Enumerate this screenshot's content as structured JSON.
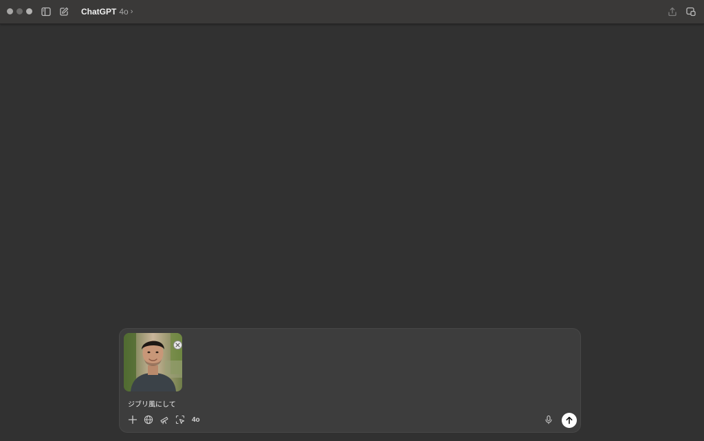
{
  "window": {
    "title": "ChatGPT",
    "model": "4o",
    "chevron": "›"
  },
  "icons": {
    "sidebar": "sidebar-toggle-icon",
    "new_chat": "compose-icon",
    "share": "share-icon",
    "window_mode": "companion-window-icon"
  },
  "composer": {
    "prompt": "ジブリ風にして",
    "attachment": {
      "kind": "photo",
      "description_icon": "portrait-photo-thumbnail"
    },
    "tools": [
      "plus-icon",
      "globe-icon",
      "telescope-icon",
      "screen-select-icon"
    ],
    "model_tag": "4o"
  },
  "colors": {
    "background": "#313131",
    "titlebar": "#3a3938",
    "composer": "#3d3d3d",
    "send_button": "#ffffff"
  }
}
